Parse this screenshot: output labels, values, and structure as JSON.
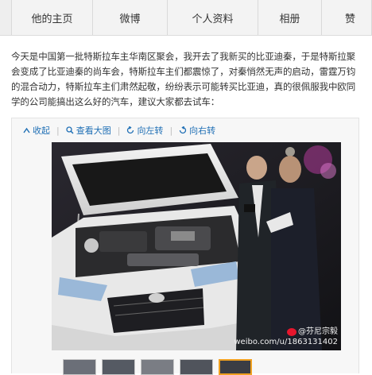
{
  "nav": {
    "tabs": [
      "他的主页",
      "微博",
      "个人资料",
      "相册",
      "赞"
    ]
  },
  "post": {
    "text": "今天是中国第一批特斯拉车主华南区聚会，我开去了我新买的比亚迪秦，于是特斯拉聚会变成了比亚迪秦的尚车会，特斯拉车主们都震惊了，对秦悄然无声的启动，雷霆万钧的混合动力，特斯拉车主们肃然起敬，纷纷表示可能转买比亚迪，真的很佩服我中欧同学的公司能搞出这么好的汽车，建议大家都去试车："
  },
  "viewer": {
    "tools": [
      {
        "icon": "collapse-icon",
        "label": "收起"
      },
      {
        "icon": "magnify-icon",
        "label": "查看大图"
      },
      {
        "icon": "rotate-left-icon",
        "label": "向左转"
      },
      {
        "icon": "rotate-right-icon",
        "label": "向右转"
      }
    ],
    "watermark": {
      "name": "@芬尼宗毅",
      "url": "weibo.com/u/1863131402"
    },
    "thumbnails_count": 5,
    "active_thumbnail": 5
  },
  "colors": {
    "link": "#1f6fb5",
    "active_thumb": "#f0a020",
    "nav_bg": "#eeeeee"
  }
}
